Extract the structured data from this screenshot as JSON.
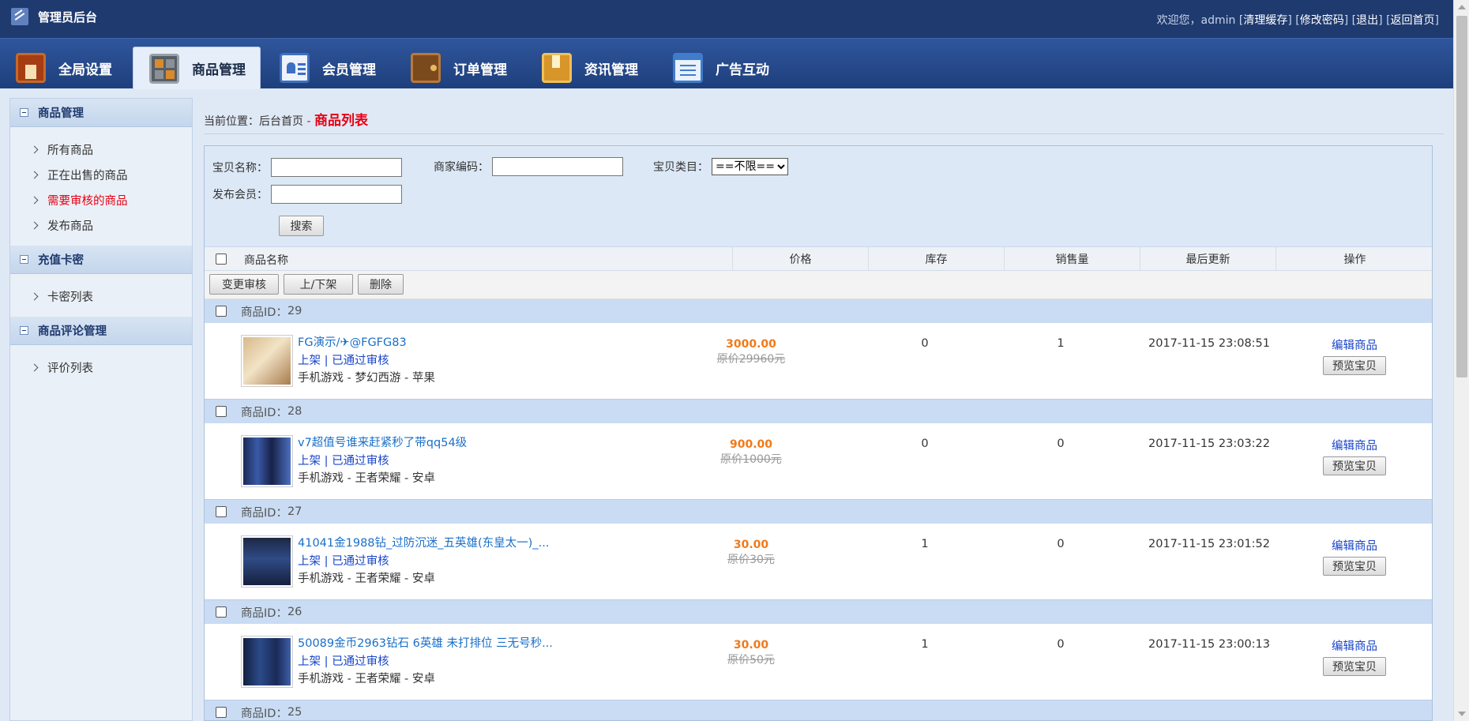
{
  "header": {
    "title": "管理员后台",
    "welcome": "欢迎您，admin",
    "links": [
      "清理缓存",
      "修改密码",
      "退出",
      "返回首页"
    ]
  },
  "nav": {
    "tabs": [
      {
        "label": "全局设置",
        "icon": "global-settings-icon"
      },
      {
        "label": "商品管理",
        "icon": "goods-icon"
      },
      {
        "label": "会员管理",
        "icon": "member-icon"
      },
      {
        "label": "订单管理",
        "icon": "wallet-icon"
      },
      {
        "label": "资讯管理",
        "icon": "news-icon"
      },
      {
        "label": "广告互动",
        "icon": "ads-icon"
      }
    ],
    "active": "商品管理"
  },
  "sidebar": {
    "groups": [
      {
        "title": "商品管理",
        "items": [
          "所有商品",
          "正在出售的商品",
          "需要审核的商品",
          "发布商品"
        ]
      },
      {
        "title": "充值卡密",
        "items": [
          "卡密列表"
        ]
      },
      {
        "title": "商品评论管理",
        "items": [
          "评价列表"
        ]
      }
    ],
    "active_item": "需要审核的商品"
  },
  "breadcrumb": {
    "prefix": "当前位置：",
    "home": "后台首页",
    "separator": " - ",
    "current": "商品列表"
  },
  "search": {
    "name_label": "宝贝名称：",
    "code_label": "商家编码：",
    "category_label": "宝贝类目：",
    "category_value": "==不限==",
    "member_label": "发布会员：",
    "button": "搜索"
  },
  "table": {
    "columns": [
      "商品名称",
      "价格",
      "库存",
      "销售量",
      "最后更新",
      "操作"
    ],
    "batch_buttons": [
      "变更审核",
      "上/下架",
      "删除"
    ],
    "id_prefix": "商品ID：",
    "edit_label": "编辑商品",
    "preview_label": "预览宝贝",
    "rows": [
      {
        "id": "29",
        "name": "FG演示/✈@FGFG83",
        "status_on": "上架",
        "status_sep": " | ",
        "status_audit": "已通过审核",
        "category": "手机游戏 - 梦幻西游 - 苹果",
        "price": "3000.00",
        "orig": "原价29960元",
        "stock": "0",
        "sales": "1",
        "updated": "2017-11-15 23:08:51"
      },
      {
        "id": "28",
        "name": "v7超值号谁来赶紧秒了带qq54级",
        "status_on": "上架",
        "status_sep": " | ",
        "status_audit": "已通过审核",
        "category": "手机游戏 - 王者荣耀 - 安卓",
        "price": "900.00",
        "orig": "原价1000元",
        "stock": "0",
        "sales": "0",
        "updated": "2017-11-15 23:03:22"
      },
      {
        "id": "27",
        "name": "41041金1988钻_过防沉迷_五英雄(东皇太一)_...",
        "status_on": "上架",
        "status_sep": " | ",
        "status_audit": "已通过审核",
        "category": "手机游戏 - 王者荣耀 - 安卓",
        "price": "30.00",
        "orig": "原价30元",
        "stock": "1",
        "sales": "0",
        "updated": "2017-11-15 23:01:52"
      },
      {
        "id": "26",
        "name": "50089金币2963钻石 6英雄 未打排位 三无号秒...",
        "status_on": "上架",
        "status_sep": " | ",
        "status_audit": "已通过审核",
        "category": "手机游戏 - 王者荣耀 - 安卓",
        "price": "30.00",
        "orig": "原价50元",
        "stock": "1",
        "sales": "0",
        "updated": "2017-11-15 23:00:13"
      }
    ],
    "partial_row_id": "25"
  },
  "colors": {
    "accent_red": "#e60012",
    "link_blue": "#1a6fc9",
    "price_orange": "#f07a1a",
    "header_navy": "#1f3a6e"
  }
}
